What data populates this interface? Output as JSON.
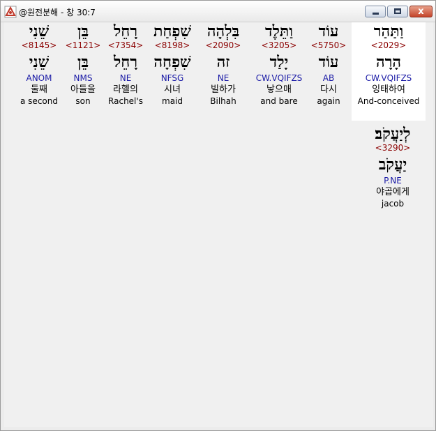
{
  "window": {
    "title": "@원전분해 - 창 30:7",
    "buttons": [
      "minimize-icon",
      "maximize-icon",
      "close-icon"
    ],
    "close_glyph": "x"
  },
  "colors": {
    "strong_number": "#8b0000",
    "morphology": "#1a1aa6",
    "selected_background": "#ffffff",
    "panel_background": "#f0f0f0"
  },
  "words": [
    {
      "hebrew": "וַתַּהַר",
      "strong": "<2029>",
      "root": "הָרָה",
      "morph": "CW.VQIFZS",
      "korean": "잉태하여",
      "english": "And-conceived"
    },
    {
      "hebrew": "עוֹד",
      "strong": "<5750>",
      "root": "עוֹד",
      "morph": "AB",
      "korean": "다시",
      "english": "again"
    },
    {
      "hebrew": "וַתֵּלֶד",
      "strong": "<3205>",
      "root": "יָלַד",
      "morph": "CW.VQIFZS",
      "korean": "낳으매",
      "english": "and bare"
    },
    {
      "hebrew": "בִּלְהָה",
      "strong": "<2090>",
      "root": "זה",
      "morph": "NE",
      "korean": "빌하가",
      "english": "Bilhah"
    },
    {
      "hebrew": "שִׁפְחַת",
      "strong": "<8198>",
      "root": "שִׁפְחָה",
      "morph": "NFSG",
      "korean": "시녀",
      "english": "maid"
    },
    {
      "hebrew": "רָחֵל",
      "strong": "<7354>",
      "root": "רָחֵל",
      "morph": "NE",
      "korean": "라헬의",
      "english": "Rachel's"
    },
    {
      "hebrew": "בֵּן",
      "strong": "<1121>",
      "root": "בֵּן",
      "morph": "NMS",
      "korean": "아들을",
      "english": "son"
    },
    {
      "hebrew": "שֵׁנִי",
      "strong": "<8145>",
      "root": "שֵׁנִי",
      "morph": "ANOM",
      "korean": "둘째",
      "english": "a second"
    },
    {
      "hebrew": "לְיַעֲקֹב׃",
      "strong": "<3290>",
      "root": "יַעֲקֹב",
      "morph": "P.NE",
      "korean": "야곱에게",
      "english": "jacob"
    }
  ]
}
